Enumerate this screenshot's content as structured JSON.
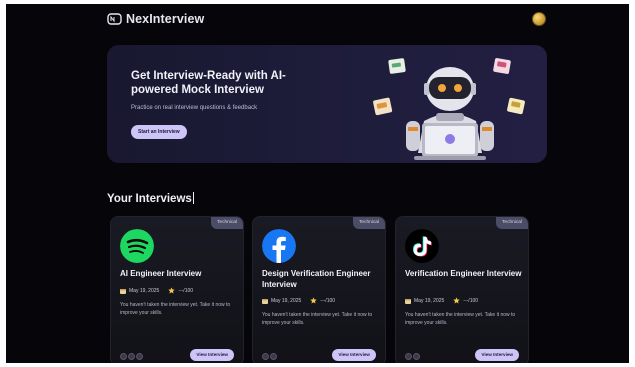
{
  "header": {
    "brand": "NexInterview"
  },
  "hero": {
    "title": "Get Interview-Ready with AI-powered Mock Interview",
    "subtitle": "Practice on real interview questions & feedback",
    "cta_label": "Start an Interview"
  },
  "section": {
    "title": "Your Interviews"
  },
  "cards": [
    {
      "tag": "Technical",
      "logo": "spotify-logo",
      "title": "AI Engineer Interview",
      "date": "May 19, 2025",
      "score": "---/100",
      "description": "You haven't taken the interview yet. Take it now to improve your skills.",
      "button": "View Interview"
    },
    {
      "tag": "Technical",
      "logo": "facebook-logo",
      "title": "Design Verification Engineer Interview",
      "date": "May 19, 2025",
      "score": "---/100",
      "description": "You haven't taken the interview yet. Take it now to improve your skills.",
      "button": "View Interview"
    },
    {
      "tag": "Technical",
      "logo": "tiktok-logo",
      "title": "Verification Engineer Interview",
      "date": "May 19, 2025",
      "score": "---/100",
      "description": "You haven't taken the interview yet. Take it now to improve your skills.",
      "button": "View Interview"
    }
  ],
  "colors": {
    "page_bg": "#06060a",
    "hero_bg": "#1d1c39",
    "accent": "#cdc4f7",
    "spotify": "#1ed760",
    "facebook": "#1877f2"
  }
}
